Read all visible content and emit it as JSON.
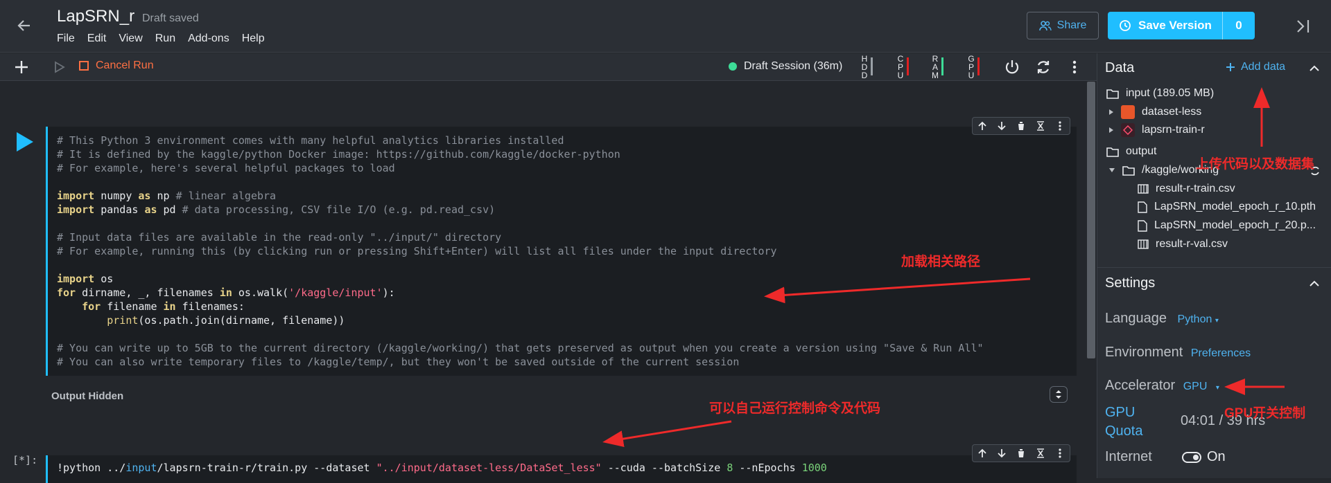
{
  "header": {
    "title": "LapSRN_r",
    "draft_status": "Draft saved",
    "menu": [
      "File",
      "Edit",
      "View",
      "Run",
      "Add-ons",
      "Help"
    ],
    "share_label": "Share",
    "save_label": "Save Version",
    "save_count": "0"
  },
  "toolbar": {
    "cancel_label": "Cancel Run",
    "session_label": "Draft Session (36m)",
    "meters": [
      {
        "label": "HDD",
        "color": "#9aa0a6"
      },
      {
        "label": "CPU",
        "color": "#e02020"
      },
      {
        "label": "RAM",
        "color": "#3ddc97"
      },
      {
        "label": "GPU",
        "color": "#e02020"
      }
    ]
  },
  "cell1": {
    "lines": [
      "# This Python 3 environment comes with many helpful analytics libraries installed",
      "# It is defined by the kaggle/python Docker image: https://github.com/kaggle/docker-python",
      "# For example, here's several helpful packages to load",
      "",
      "import numpy as np # linear algebra",
      "import pandas as pd # data processing, CSV file I/O (e.g. pd.read_csv)",
      "",
      "# Input data files are available in the read-only \"../input/\" directory",
      "# For example, running this (by clicking run or pressing Shift+Enter) will list all files under the input directory",
      "",
      "import os",
      "for dirname, _, filenames in os.walk('/kaggle/input'):",
      "    for filename in filenames:",
      "        print(os.path.join(dirname, filename))",
      "",
      "# You can write up to 5GB to the current directory (/kaggle/working/) that gets preserved as output when you create a version using \"Save & Run All\"",
      "# You can also write temporary files to /kaggle/temp/, but they won't be saved outside of the current session"
    ]
  },
  "output_hidden": "Output Hidden",
  "cell2": {
    "exec_count": "[*]:",
    "code": "!python ../input/lapsrn-train-r/train.py --dataset \"../input/dataset-less/DataSet_less\" --cuda --batchSize 8 --nEpochs 1000"
  },
  "side": {
    "data_title": "Data",
    "add_data": "Add data",
    "input_label": "input (189.05 MB)",
    "input_items": [
      "dataset-less",
      "lapsrn-train-r"
    ],
    "output_label": "output",
    "working_label": "/kaggle/working",
    "files": [
      "result-r-train.csv",
      "LapSRN_model_epoch_r_10.pth",
      "LapSRN_model_epoch_r_20.p...",
      "result-r-val.csv"
    ],
    "settings_title": "Settings",
    "language_label": "Language",
    "language_value": "Python",
    "environment_label": "Environment",
    "environment_value": "Preferences",
    "accelerator_label": "Accelerator",
    "accelerator_value": "GPU",
    "quota_label_1": "GPU",
    "quota_label_2": "Quota",
    "quota_value": "04:01 / 39 hrs",
    "internet_label": "Internet",
    "internet_value": "On"
  },
  "annotations": {
    "upload": "上传代码以及数据集",
    "path": "加载相关路径",
    "commands": "可以自己运行控制命令及代码",
    "gpu": "GPU开关控制"
  },
  "colors": {
    "accent": "#20beff",
    "annotation": "#ee2a2a",
    "cancel": "#ff7043"
  }
}
